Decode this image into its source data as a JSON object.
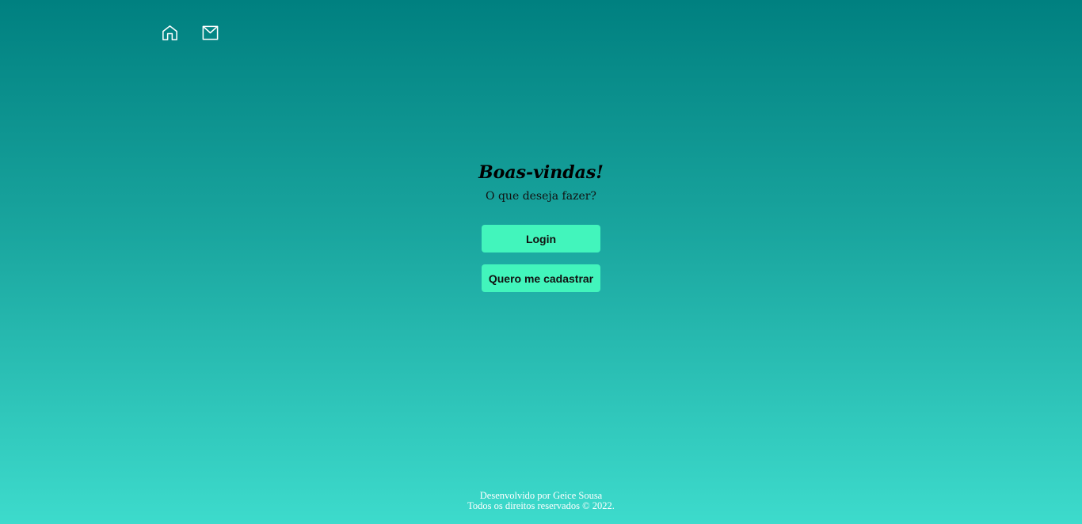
{
  "nav": {
    "home_icon": "home-icon",
    "mail_icon": "mail-icon"
  },
  "main": {
    "title": "Boas-vindas!",
    "subtitle": "O que deseja fazer?",
    "login_label": "Login",
    "register_label": "Quero me cadastrar"
  },
  "footer": {
    "line1": "Desenvolvido por Geice Sousa",
    "line2": "Todos os direitos reservados © 2022."
  },
  "colors": {
    "background_top": "#008080",
    "background_bottom": "#3ddbcc",
    "button": "#42f5bc"
  }
}
